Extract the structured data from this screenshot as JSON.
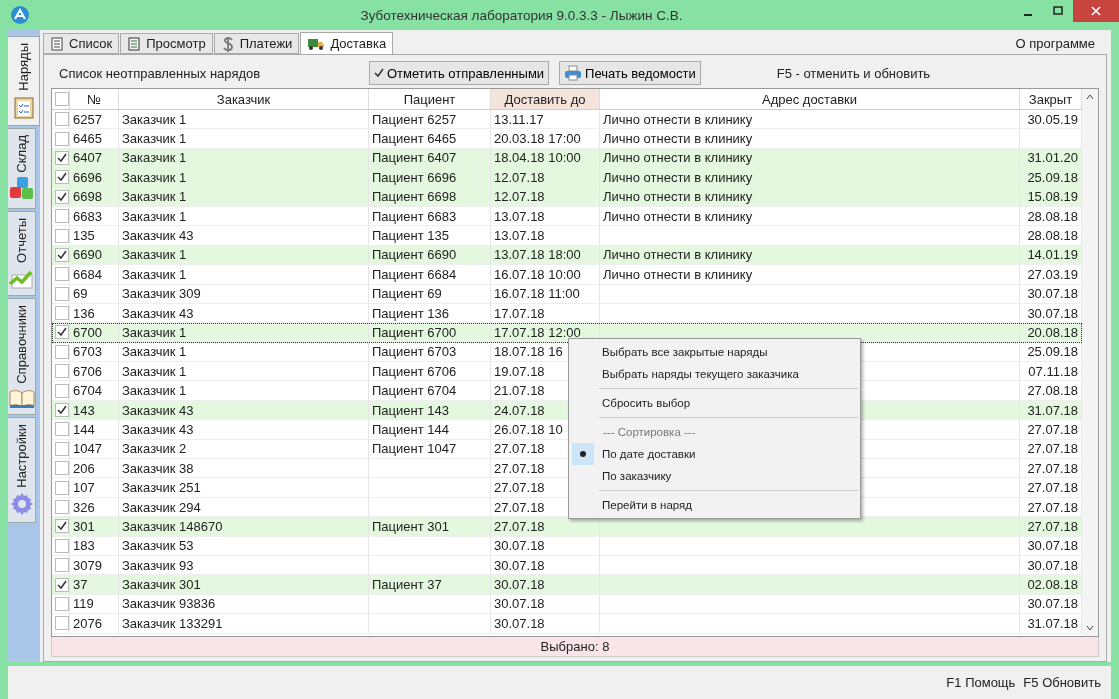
{
  "window": {
    "title": "Зуботехническая лаборатория 9.0.3.3 - Лыжин С.В."
  },
  "sidebar": {
    "items": [
      {
        "label": "Наряды",
        "selected": true,
        "kind": "clipboard"
      },
      {
        "label": "Склад",
        "selected": false,
        "kind": "blocks"
      },
      {
        "label": "Отчеты",
        "selected": false,
        "kind": "chart"
      },
      {
        "label": "Справочники",
        "selected": false,
        "kind": "book"
      },
      {
        "label": "Настройки",
        "selected": false,
        "kind": "gear"
      }
    ]
  },
  "tabs": [
    {
      "label": "Список",
      "selected": false,
      "kind": "list"
    },
    {
      "label": "Просмотр",
      "selected": false,
      "kind": "doc"
    },
    {
      "label": "Платежи",
      "selected": false,
      "kind": "dollar"
    },
    {
      "label": "Доставка",
      "selected": true,
      "kind": "truck"
    }
  ],
  "about_link": "О программе",
  "toolbar": {
    "title": "Список неотправленных нарядов",
    "mark_button": "Отметить отправленными",
    "print_button": "Печать ведомости",
    "hint": "F5 - отменить и обновить"
  },
  "table": {
    "select_all": {
      "checked": false
    },
    "columns": [
      {
        "label": "№",
        "sorted": false
      },
      {
        "label": "Заказчик",
        "sorted": false
      },
      {
        "label": "Пациент",
        "sorted": false
      },
      {
        "label": "Доставить до",
        "sorted": true
      },
      {
        "label": "Адрес доставки",
        "sorted": false
      },
      {
        "label": "Закрыт",
        "sorted": false
      }
    ],
    "rows": [
      {
        "checked": false,
        "selected": false,
        "cells": [
          "6257",
          "Заказчик 1",
          "Пациент 6257",
          "13.11.17",
          "Лично отнести в клинику",
          "30.05.19"
        ]
      },
      {
        "checked": false,
        "selected": false,
        "cells": [
          "6465",
          "Заказчик 1",
          "Пациент 6465",
          "20.03.18 17:00",
          "Лично отнести в клинику",
          ""
        ]
      },
      {
        "checked": true,
        "selected": false,
        "cells": [
          "6407",
          "Заказчик 1",
          "Пациент 6407",
          "18.04.18 10:00",
          "Лично отнести в клинику",
          "31.01.20"
        ]
      },
      {
        "checked": true,
        "selected": false,
        "cells": [
          "6696",
          "Заказчик 1",
          "Пациент 6696",
          "12.07.18",
          "Лично отнести в клинику",
          "25.09.18"
        ]
      },
      {
        "checked": true,
        "selected": false,
        "cells": [
          "6698",
          "Заказчик 1",
          "Пациент 6698",
          "12.07.18",
          "Лично отнести в клинику",
          "15.08.19"
        ]
      },
      {
        "checked": false,
        "selected": false,
        "cells": [
          "6683",
          "Заказчик 1",
          "Пациент 6683",
          "13.07.18",
          "Лично отнести в клинику",
          "28.08.18"
        ]
      },
      {
        "checked": false,
        "selected": false,
        "cells": [
          "135",
          "Заказчик 43",
          "Пациент 135",
          "13.07.18",
          "",
          "28.08.18"
        ]
      },
      {
        "checked": true,
        "selected": false,
        "cells": [
          "6690",
          "Заказчик 1",
          "Пациент 6690",
          "13.07.18 18:00",
          "Лично отнести в клинику",
          "14.01.19"
        ]
      },
      {
        "checked": false,
        "selected": false,
        "cells": [
          "6684",
          "Заказчик 1",
          "Пациент 6684",
          "16.07.18 10:00",
          "Лично отнести в клинику",
          "27.03.19"
        ]
      },
      {
        "checked": false,
        "selected": false,
        "cells": [
          "69",
          "Заказчик 309",
          "Пациент 69",
          "16.07.18 11:00",
          "",
          "30.07.18"
        ]
      },
      {
        "checked": false,
        "selected": false,
        "cells": [
          "136",
          "Заказчик 43",
          "Пациент 136",
          "17.07.18",
          "",
          "30.07.18"
        ]
      },
      {
        "checked": true,
        "selected": true,
        "cells": [
          "6700",
          "Заказчик 1",
          "Пациент 6700",
          "17.07.18 12:00",
          "",
          "20.08.18"
        ]
      },
      {
        "checked": false,
        "selected": false,
        "cells": [
          "6703",
          "Заказчик 1",
          "Пациент 6703",
          "18.07.18 16",
          "",
          "25.09.18"
        ]
      },
      {
        "checked": false,
        "selected": false,
        "cells": [
          "6706",
          "Заказчик 1",
          "Пациент 6706",
          "19.07.18",
          "",
          "07.11.18"
        ]
      },
      {
        "checked": false,
        "selected": false,
        "cells": [
          "6704",
          "Заказчик 1",
          "Пациент 6704",
          "21.07.18",
          "",
          "27.08.18"
        ]
      },
      {
        "checked": true,
        "selected": false,
        "cells": [
          "143",
          "Заказчик 43",
          "Пациент 143",
          "24.07.18",
          "",
          "31.07.18"
        ]
      },
      {
        "checked": false,
        "selected": false,
        "cells": [
          "144",
          "Заказчик 43",
          "Пациент 144",
          "26.07.18 10",
          "",
          "27.07.18"
        ]
      },
      {
        "checked": false,
        "selected": false,
        "cells": [
          "1047",
          "Заказчик 2",
          "Пациент 1047",
          "27.07.18",
          "",
          "27.07.18"
        ]
      },
      {
        "checked": false,
        "selected": false,
        "cells": [
          "206",
          "Заказчик 38",
          "",
          "27.07.18",
          "",
          "27.07.18"
        ]
      },
      {
        "checked": false,
        "selected": false,
        "cells": [
          "107",
          "Заказчик 251",
          "",
          "27.07.18",
          "",
          "27.07.18"
        ]
      },
      {
        "checked": false,
        "selected": false,
        "cells": [
          "326",
          "Заказчик 294",
          "",
          "27.07.18",
          "",
          "27.07.18"
        ]
      },
      {
        "checked": true,
        "selected": false,
        "cells": [
          "301",
          "Заказчик 148670",
          "Пациент 301",
          "27.07.18",
          "",
          "27.07.18"
        ]
      },
      {
        "checked": false,
        "selected": false,
        "cells": [
          "183",
          "Заказчик 53",
          "",
          "30.07.18",
          "",
          "30.07.18"
        ]
      },
      {
        "checked": false,
        "selected": false,
        "cells": [
          "3079",
          "Заказчик 93",
          "",
          "30.07.18",
          "",
          "30.07.18"
        ]
      },
      {
        "checked": true,
        "selected": false,
        "cells": [
          "37",
          "Заказчик 301",
          "Пациент 37",
          "30.07.18",
          "",
          "02.08.18"
        ]
      },
      {
        "checked": false,
        "selected": false,
        "cells": [
          "119",
          "Заказчик 93836",
          "",
          "30.07.18",
          "",
          "30.07.18"
        ]
      },
      {
        "checked": false,
        "selected": false,
        "cells": [
          "2076",
          "Заказчик 133291",
          "",
          "30.07.18",
          "",
          "31.07.18"
        ]
      }
    ]
  },
  "footer": "Выбрано: 8",
  "context_menu": [
    {
      "kind": "item",
      "label": "Выбрать все закрытые наряды"
    },
    {
      "kind": "item",
      "label": "Выбрать наряды текущего заказчика"
    },
    {
      "kind": "separator"
    },
    {
      "kind": "item",
      "label": "Сбросить выбор"
    },
    {
      "kind": "separator"
    },
    {
      "kind": "header",
      "label": "--- Сортировка ---"
    },
    {
      "kind": "radio",
      "label": "По дате доставки",
      "selected": true
    },
    {
      "kind": "radio",
      "label": "По заказчику",
      "selected": false
    },
    {
      "kind": "separator"
    },
    {
      "kind": "item",
      "label": "Перейти в наряд"
    }
  ],
  "status_bar": [
    "F1 Помощь",
    "F5 Обновить"
  ]
}
